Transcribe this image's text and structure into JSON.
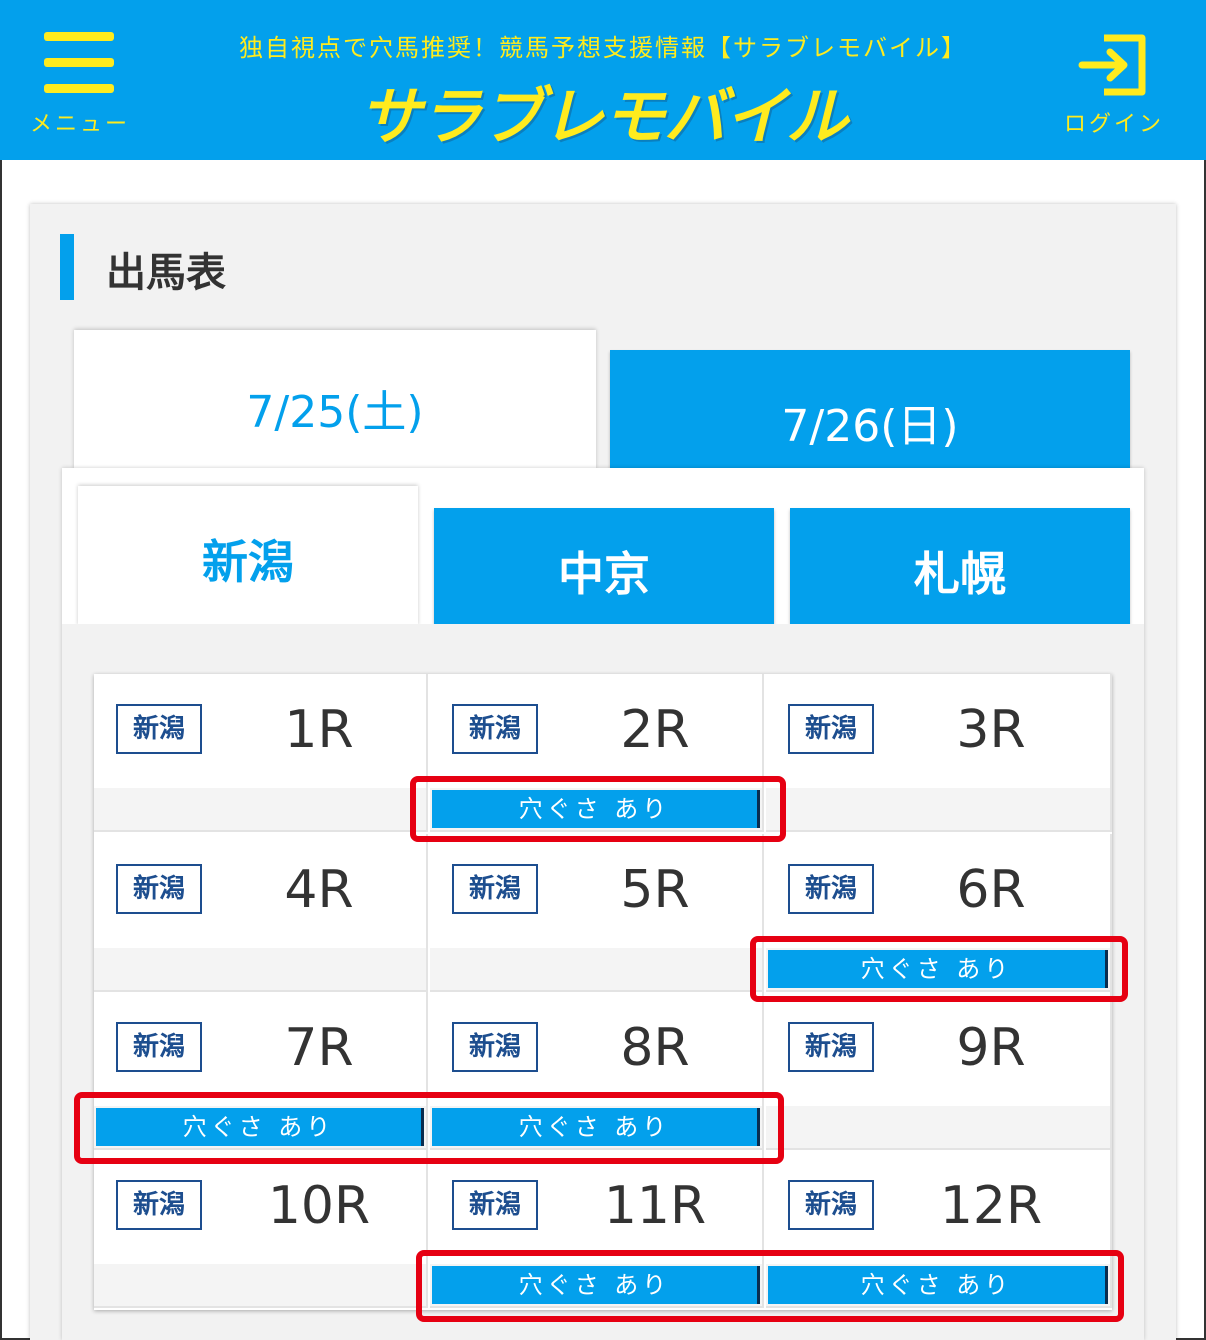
{
  "header": {
    "menu_label": "メニュー",
    "tagline": "独自視点で穴馬推奨！競馬予想支援情報【サラブレモバイル】",
    "brand": "サラブレモバイル",
    "login_label": "ログイン",
    "bg_color": "#03a0ec",
    "accent_color": "#ffeb1e"
  },
  "section": {
    "title": "出馬表"
  },
  "date_tabs": [
    {
      "label": "7/25(土)",
      "active": true
    },
    {
      "label": "7/26(日)",
      "active": false
    }
  ],
  "venue_tabs": [
    {
      "label": "新潟",
      "active": true
    },
    {
      "label": "中京",
      "active": false
    },
    {
      "label": "札幌",
      "active": false
    }
  ],
  "races": [
    {
      "venue": "新潟",
      "race": "1R",
      "tag": ""
    },
    {
      "venue": "新潟",
      "race": "2R",
      "tag": "穴ぐさ あり"
    },
    {
      "venue": "新潟",
      "race": "3R",
      "tag": ""
    },
    {
      "venue": "新潟",
      "race": "4R",
      "tag": ""
    },
    {
      "venue": "新潟",
      "race": "5R",
      "tag": ""
    },
    {
      "venue": "新潟",
      "race": "6R",
      "tag": "穴ぐさ あり"
    },
    {
      "venue": "新潟",
      "race": "7R",
      "tag": "穴ぐさ あり"
    },
    {
      "venue": "新潟",
      "race": "8R",
      "tag": "穴ぐさ あり"
    },
    {
      "venue": "新潟",
      "race": "9R",
      "tag": ""
    },
    {
      "venue": "新潟",
      "race": "10R",
      "tag": ""
    },
    {
      "venue": "新潟",
      "race": "11R",
      "tag": "穴ぐさ あり"
    },
    {
      "venue": "新潟",
      "race": "12R",
      "tag": "穴ぐさ あり"
    }
  ],
  "colors": {
    "brand_blue": "#03a0ec",
    "badge_navy": "#1d4e8f",
    "highlight_red": "#e60012"
  }
}
